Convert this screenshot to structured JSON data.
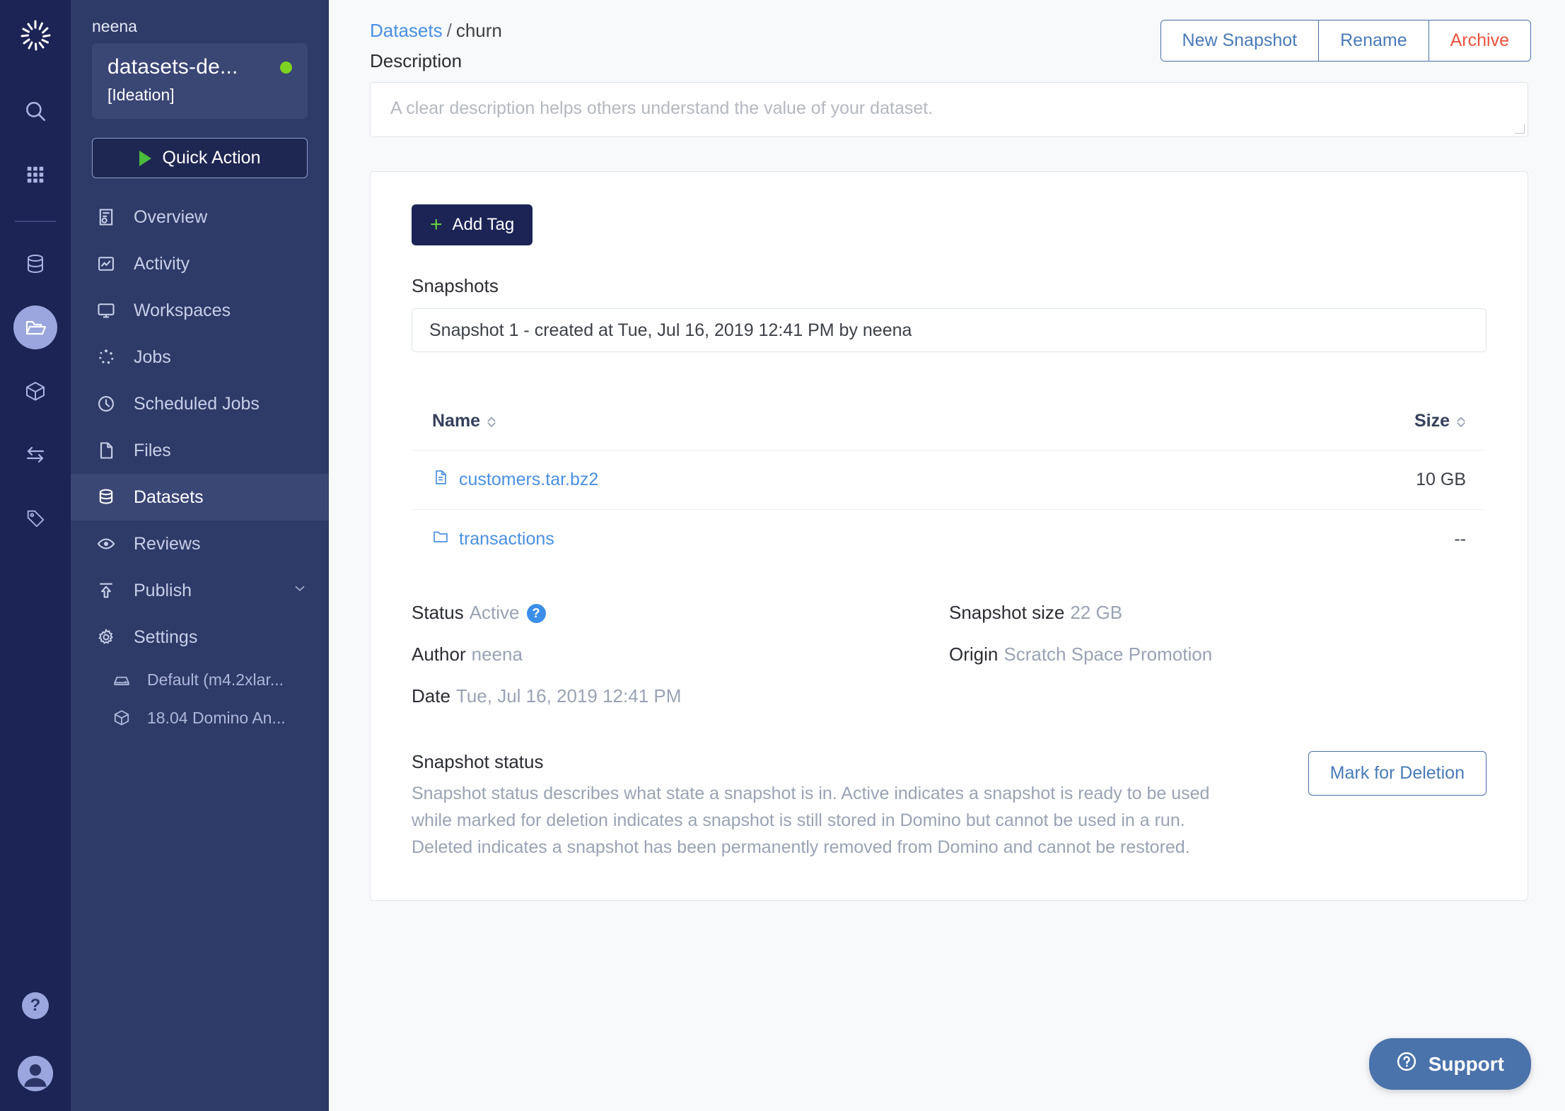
{
  "rail": {
    "logo_icon": "domino-logo-icon",
    "items": [
      {
        "icon": "search-icon",
        "name": "search"
      },
      {
        "icon": "grid-apps-icon",
        "name": "apps"
      },
      {
        "icon": "database-icon",
        "name": "data"
      },
      {
        "icon": "folder-open-icon",
        "name": "projects",
        "active": true
      },
      {
        "icon": "cube-icon",
        "name": "environments"
      },
      {
        "icon": "transfer-arrows-icon",
        "name": "transfers"
      },
      {
        "icon": "tag-icon",
        "name": "tags"
      }
    ],
    "help_label": "?",
    "avatar_icon": "user-avatar-icon"
  },
  "sidebar": {
    "user": "neena",
    "project_name": "datasets-de...",
    "project_stage": "[Ideation]",
    "status_dot_color": "#7ed321",
    "quick_action": "Quick Action",
    "items": [
      {
        "label": "Overview",
        "icon": "overview-icon"
      },
      {
        "label": "Activity",
        "icon": "activity-icon"
      },
      {
        "label": "Workspaces",
        "icon": "monitor-icon"
      },
      {
        "label": "Jobs",
        "icon": "jobs-spinner-icon"
      },
      {
        "label": "Scheduled Jobs",
        "icon": "clock-icon"
      },
      {
        "label": "Files",
        "icon": "file-icon"
      },
      {
        "label": "Datasets",
        "icon": "database-icon",
        "active": true
      },
      {
        "label": "Reviews",
        "icon": "eye-icon"
      },
      {
        "label": "Publish",
        "icon": "publish-upload-icon",
        "has_chevron": true
      },
      {
        "label": "Settings",
        "icon": "gear-icon"
      }
    ],
    "sub_items": [
      {
        "label": "Default (m4.2xlar...",
        "icon": "hardware-tier-icon"
      },
      {
        "label": "18.04 Domino An...",
        "icon": "cube-icon"
      }
    ]
  },
  "header": {
    "breadcrumb_root": "Datasets",
    "breadcrumb_sep": "/",
    "breadcrumb_current": "churn",
    "description_label": "Description",
    "actions": [
      {
        "label": "New Snapshot",
        "style": "primary-link"
      },
      {
        "label": "Rename",
        "style": "primary-link"
      },
      {
        "label": "Archive",
        "style": "danger"
      }
    ]
  },
  "description": {
    "value": "",
    "placeholder": "A clear description helps others understand the value of your dataset."
  },
  "panel": {
    "add_tag_label": "Add Tag",
    "snapshots_label": "Snapshots",
    "snapshot_selected": "Snapshot 1 - created at Tue, Jul 16, 2019 12:41 PM by neena",
    "table": {
      "columns": [
        "Name",
        "Size"
      ],
      "rows": [
        {
          "name": "customers.tar.bz2",
          "icon": "file-icon",
          "size": "10 GB"
        },
        {
          "name": "transactions",
          "icon": "folder-icon",
          "size": "--"
        }
      ]
    },
    "meta_left": [
      {
        "label": "Status",
        "value": "Active",
        "has_help": true
      },
      {
        "label": "Author",
        "value": "neena"
      },
      {
        "label": "Date",
        "value": "Tue, Jul 16, 2019 12:41 PM"
      }
    ],
    "meta_right": [
      {
        "label": "Snapshot size",
        "value": "22 GB"
      },
      {
        "label": "Origin",
        "value": "Scratch Space Promotion"
      }
    ],
    "status_title": "Snapshot status",
    "status_desc": "Snapshot status describes what state a snapshot is in. Active indicates a snapshot is ready to be used while marked for deletion indicates a snapshot is still stored in Domino but cannot be used in a run. Deleted indicates a snapshot has been permanently removed from Domino and cannot be restored.",
    "mark_deletion_label": "Mark for Deletion"
  },
  "support": {
    "label": "Support",
    "icon": "question-circle-icon"
  },
  "colors": {
    "rail_bg": "#1b2455",
    "sidebar_bg": "#2e3a67",
    "accent_blue": "#4a90e2",
    "danger_red": "#e8533f",
    "green": "#67cf3f",
    "support_blue": "#4a72ab"
  }
}
